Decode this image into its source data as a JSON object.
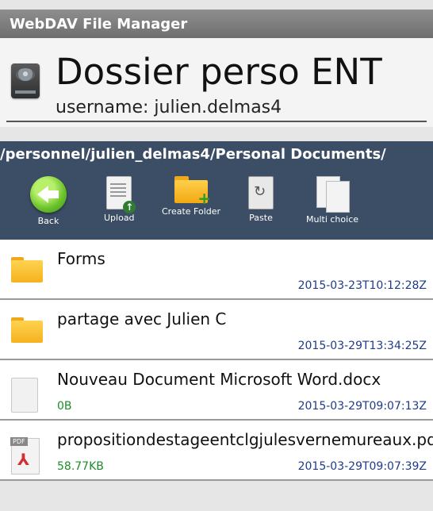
{
  "app": {
    "title": "WebDAV File Manager"
  },
  "account": {
    "name": "Dossier perso ENT",
    "username": "username: julien.delmas4"
  },
  "path": "/personnel/julien_delmas4/Personal Documents/",
  "toolbar": {
    "back": "Back",
    "upload": "Upload",
    "create_folder": "Create Folder",
    "paste": "Paste",
    "multi_choice": "Multi choice"
  },
  "files": [
    {
      "name": "Forms",
      "date": "2015-03-23T10:12:28Z",
      "size": "",
      "type": "folder"
    },
    {
      "name": "partage avec Julien C",
      "date": "2015-03-29T13:34:25Z",
      "size": "",
      "type": "folder"
    },
    {
      "name": "Nouveau Document Microsoft Word.docx",
      "date": "2015-03-29T09:07:13Z",
      "size": "0B",
      "type": "file"
    },
    {
      "name": "propositiondestageentclgjulesvernemureaux.pdf",
      "date": "2015-03-29T09:07:39Z",
      "size": "58.77KB",
      "type": "pdf"
    }
  ],
  "colors": {
    "titlebar": "#7a7a7a",
    "pathbar": "#3c4e66",
    "date": "#1f3c88",
    "size": "#1c8c2a"
  }
}
